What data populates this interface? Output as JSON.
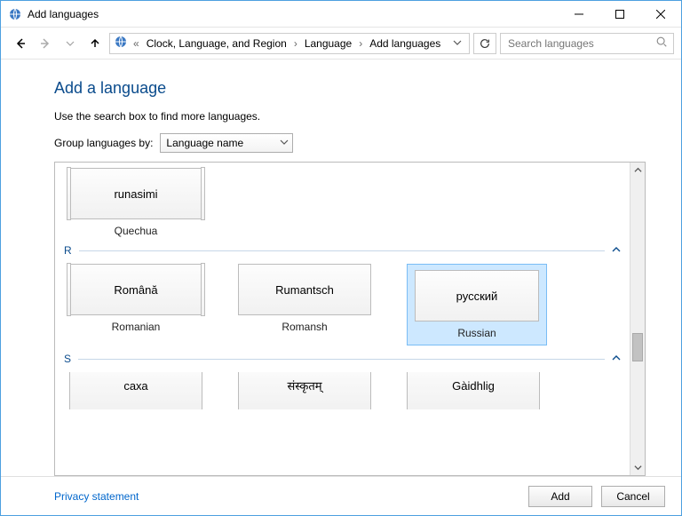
{
  "window": {
    "title": "Add languages"
  },
  "breadcrumb": {
    "items": [
      "Clock, Language, and Region",
      "Language",
      "Add languages"
    ]
  },
  "search": {
    "placeholder": "Search languages"
  },
  "page": {
    "heading": "Add a language",
    "subtext": "Use the search box to find more languages.",
    "group_label": "Group languages by:",
    "group_value": "Language name"
  },
  "sections": {
    "q_remainder": {
      "items": [
        {
          "native": "runasimi",
          "english": "Quechua",
          "stacked": true
        }
      ]
    },
    "r": {
      "letter": "R",
      "items": [
        {
          "native": "Română",
          "english": "Romanian",
          "stacked": true
        },
        {
          "native": "Rumantsch",
          "english": "Romansh",
          "stacked": false
        },
        {
          "native": "русский",
          "english": "Russian",
          "stacked": false,
          "selected": true
        }
      ]
    },
    "s": {
      "letter": "S",
      "items": [
        {
          "native": "саха",
          "english": "",
          "stacked": false
        },
        {
          "native": "संस्कृतम्",
          "english": "",
          "stacked": false
        },
        {
          "native": "Gàidhlig",
          "english": "",
          "stacked": false
        }
      ]
    }
  },
  "footer": {
    "privacy": "Privacy statement",
    "add": "Add",
    "cancel": "Cancel"
  }
}
